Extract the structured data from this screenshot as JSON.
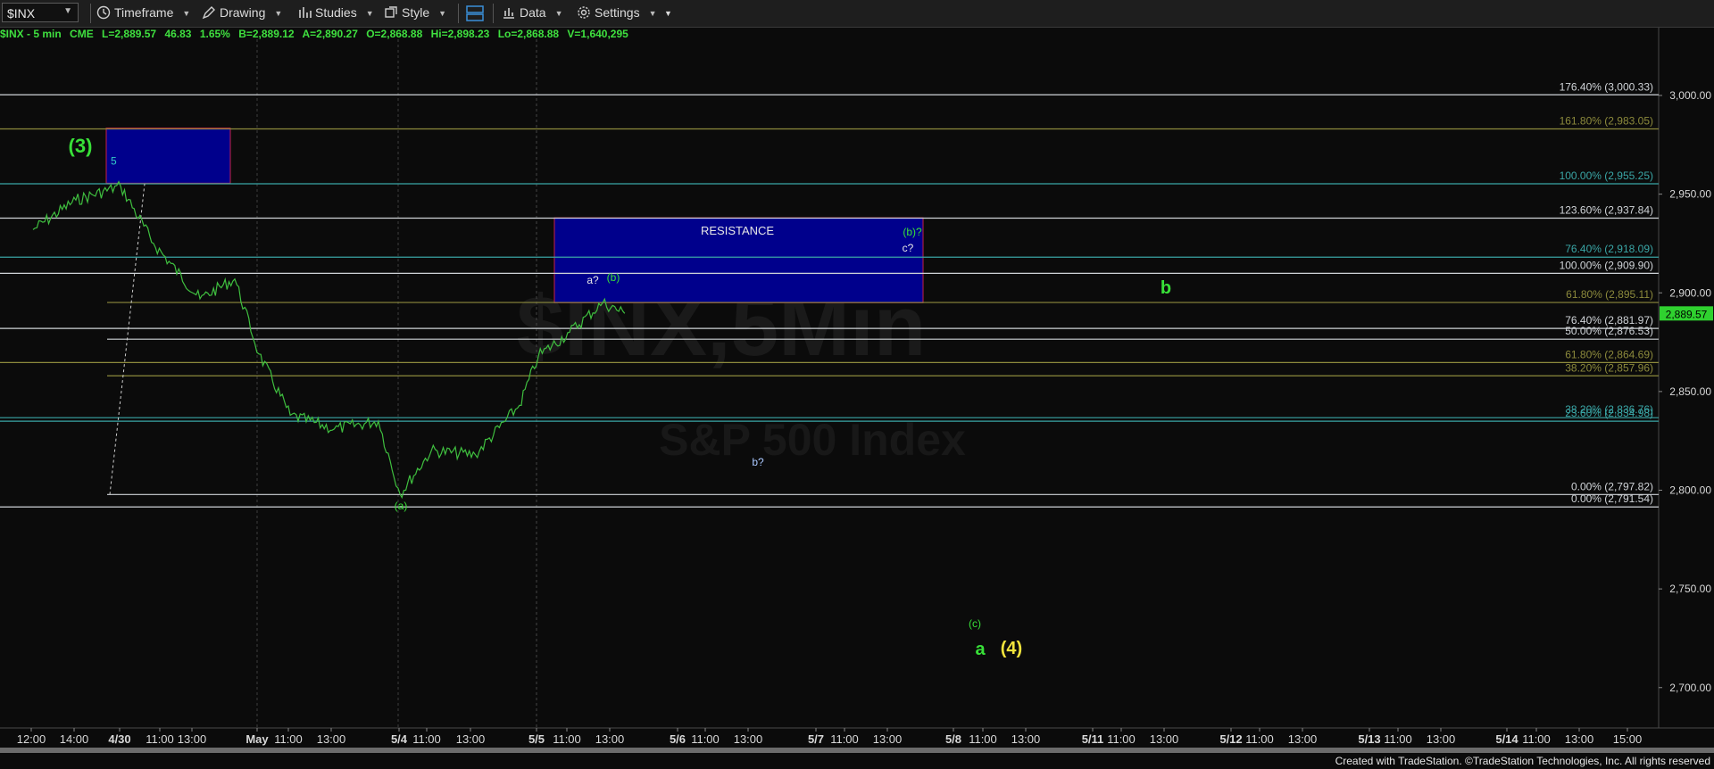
{
  "toolbar": {
    "symbol": "$INX",
    "items": [
      {
        "label": "Timeframe",
        "icon": "clock-icon"
      },
      {
        "label": "Drawing",
        "icon": "drawing-pencil-icon"
      },
      {
        "label": "Studies",
        "icon": "studies-chart-icon"
      },
      {
        "label": "Style",
        "icon": "style-icon"
      },
      {
        "label": "",
        "icon": "layout-icon"
      },
      {
        "label": "Data",
        "icon": "data-bars-icon"
      },
      {
        "label": "Settings",
        "icon": "gear-icon"
      }
    ]
  },
  "info": {
    "symbol": "$INX - 5 min",
    "exchange": "CME",
    "last": "L=2,889.57",
    "change": "46.83",
    "pct": "1.65%",
    "bid": "B=2,889.12",
    "ask": "A=2,890.27",
    "open": "O=2,868.88",
    "high": "Hi=2,898.23",
    "low": "Lo=2,868.88",
    "volume": "V=1,640,295"
  },
  "watermark": {
    "line1": "$INX,5Min",
    "line2": "S&P 500 Index"
  },
  "footer": "Created with TradeStation. ©TradeStation Technologies, Inc. All rights reserved",
  "colors": {
    "price": "#3fbf3f",
    "box_fill": "#00008c",
    "box_border": "#c4204a",
    "fib_white": "#d0d4d8",
    "fib_olive": "#8c8a3c",
    "fib_teal": "#3aa6a6",
    "wave_green": "#38e038",
    "wave_yellow": "#f2e43c"
  },
  "chart_data": {
    "type": "line",
    "series": [
      {
        "x": [
          "4/29 12:00",
          "4/29 14:00",
          "4/30 09:35",
          "4/30 11:00",
          "4/30 13:00",
          "4/30 14:30",
          "5/1 09:35",
          "5/1 11:00",
          "5/1 13:00",
          "5/1 15:00",
          "5/4 09:35",
          "5/4 11:00",
          "5/4 13:00",
          "5/4 15:00",
          "5/5 09:35",
          "5/5 11:00",
          "5/5 12:30",
          "5/5 13:30"
        ],
        "y": [
          2932,
          2947,
          2954,
          2925,
          2897,
          2907,
          2869,
          2838,
          2831,
          2835,
          2798,
          2820,
          2818,
          2843,
          2868,
          2880,
          2895,
          2889.57
        ]
      }
    ],
    "ylim": [
      2680,
      3025
    ],
    "y_ticks": [
      "3,000.00",
      "2,950.00",
      "2,900.00",
      "2,850.00",
      "2,800.00",
      "2,750.00",
      "2,700.00"
    ],
    "y_tick_values": [
      3000,
      2950,
      2900,
      2850,
      2800,
      2750,
      2700
    ],
    "x_ticks": [
      "12:00",
      "14:00",
      "4/30",
      "11:00",
      "13:00",
      "May",
      "11:00",
      "13:00",
      "5/4",
      "11:00",
      "13:00",
      "5/5",
      "11:00",
      "13:00",
      "5/6",
      "11:00",
      "13:00",
      "5/7",
      "11:00",
      "13:00",
      "5/8",
      "11:00",
      "13:00",
      "5/11",
      "11:00",
      "13:00",
      "5/12",
      "11:00",
      "13:00",
      "5/13",
      "11:00",
      "13:00",
      "5/14",
      "11:00",
      "13:00",
      "15:00"
    ],
    "last_price_label": "2,889.57",
    "fib_levels": [
      {
        "label": "176.40% (3,000.33)",
        "value": 3000.33,
        "color": "white"
      },
      {
        "label": "161.80% (2,983.05)",
        "value": 2983.05,
        "color": "olive"
      },
      {
        "label": "100.00% (2,955.25)",
        "value": 2955.25,
        "color": "teal"
      },
      {
        "label": "123.60% (2,937.84)",
        "value": 2937.84,
        "color": "white"
      },
      {
        "label": "76.40% (2,918.09)",
        "value": 2918.09,
        "color": "teal"
      },
      {
        "label": "100.00% (2,909.90)",
        "value": 2909.9,
        "color": "white"
      },
      {
        "label": "61.80% (2,895.11)",
        "value": 2895.11,
        "color": "olive"
      },
      {
        "label": "76.40% (2,881.97)",
        "value": 2881.97,
        "color": "white"
      },
      {
        "label": "50.00% (2,876.53)",
        "value": 2876.53,
        "color": "white"
      },
      {
        "label": "61.80% (2,864.69)",
        "value": 2864.69,
        "color": "olive"
      },
      {
        "label": "38.20% (2,857.96)",
        "value": 2857.96,
        "color": "olive"
      },
      {
        "label": "38.20% (2,836.76)",
        "value": 2836.76,
        "color": "teal"
      },
      {
        "label": "23.60% (2,834.98)",
        "value": 2834.98,
        "color": "teal"
      },
      {
        "label": "0.00% (2,797.82)",
        "value": 2797.82,
        "color": "white"
      },
      {
        "label": "0.00% (2,791.54)",
        "value": 2791.54,
        "color": "white"
      }
    ],
    "zones": [
      {
        "label": "5",
        "top": 2983,
        "bottom": 2956
      },
      {
        "label": "RESISTANCE",
        "top": 2938,
        "bottom": 2895
      }
    ],
    "annotations": [
      "(3)",
      "5",
      "RESISTANCE",
      "(b)?",
      "c?",
      "a?",
      "(b)",
      "b?",
      "(a)",
      "b",
      "(c)",
      "a",
      "(4)"
    ]
  }
}
